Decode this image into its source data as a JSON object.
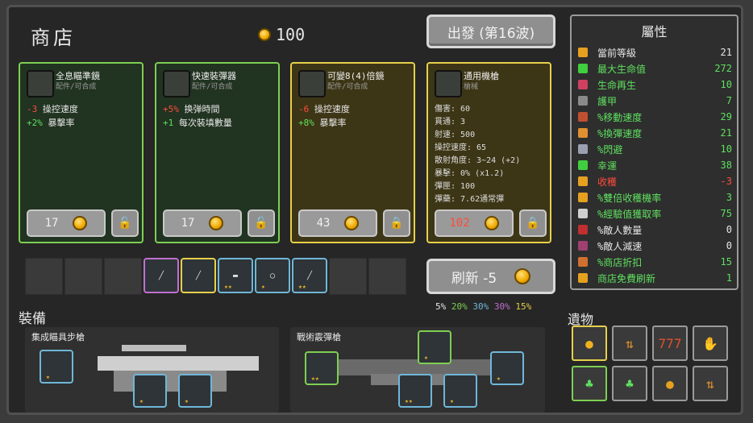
{
  "shop": {
    "title": "商店",
    "gold": "100",
    "go_button": "出發 (第16波)"
  },
  "cards": [
    {
      "name": "全息瞄準鏡",
      "sub": "配件/可合成",
      "stats": [
        {
          "v": "-3",
          "t": "操控速度",
          "c": "red"
        },
        {
          "v": "+2%",
          "t": "暴擊率",
          "c": "grn"
        }
      ],
      "price": "17",
      "icon": "holo-scope-icon"
    },
    {
      "name": "快速裝彈器",
      "sub": "配件/可合成",
      "stats": [
        {
          "v": "+5%",
          "t": "换弹時間",
          "c": "red"
        },
        {
          "v": "+1",
          "t": "每次裝填數量",
          "c": "grn"
        }
      ],
      "price": "17",
      "icon": "speed-loader-icon"
    },
    {
      "name": "可變8(4)倍鏡",
      "sub": "配件/可合成",
      "stats": [
        {
          "v": "-6",
          "t": "操控速度",
          "c": "red"
        },
        {
          "v": "+8%",
          "t": "暴擊率",
          "c": "grn"
        }
      ],
      "price": "43",
      "icon": "variable-scope-icon"
    },
    {
      "name": "通用機槍",
      "sub": "槍械",
      "wstats": [
        "傷害: 60",
        "貫通: 3",
        "射速: 500",
        "操控速度: 65",
        "散射角度: 3~24 (+2)",
        "暴擊: 0% (x1.2)",
        "彈匣: 100",
        "彈藥: 7.62通常彈"
      ],
      "price": "102",
      "icon": "machine-gun-icon"
    }
  ],
  "inventory": [
    {
      "name": "inventory-rifle",
      "color": "#c070d0",
      "stars": ""
    },
    {
      "name": "inventory-gold-rifle",
      "color": "#e6d04a",
      "stars": ""
    },
    {
      "name": "inventory-pistol",
      "color": "#6fb7d8",
      "stars": "★★"
    },
    {
      "name": "inventory-scope",
      "color": "#6fb7d8",
      "stars": "★"
    },
    {
      "name": "inventory-shotgun",
      "color": "#6fb7d8",
      "stars": "★★"
    }
  ],
  "refresh": {
    "label": "刷新 -5"
  },
  "rarity": [
    "5%",
    "20%",
    "30%",
    "30%",
    "15%"
  ],
  "rarity_colors": [
    "#e6e6e6",
    "#7ecf52",
    "#6fb7d8",
    "#c070d0",
    "#e6d04a"
  ],
  "equip": {
    "title": "裝備",
    "weapon1": "集成瞄具步槍",
    "weapon2": "戰術霰彈槍"
  },
  "attributes": {
    "title": "屬性",
    "rows": [
      {
        "label": "當前等級",
        "value": "21",
        "color": "#e6e6e6",
        "icon": "#e6a020"
      },
      {
        "label": "最大生命值",
        "value": "272",
        "color": "#5fe05f",
        "icon": "#3fcf3f"
      },
      {
        "label": "生命再生",
        "value": "10",
        "color": "#5fe05f",
        "icon": "#d04060"
      },
      {
        "label": "護甲",
        "value": "7",
        "color": "#5fe05f",
        "icon": "#8a8a8a"
      },
      {
        "label": "%移動速度",
        "value": "29",
        "color": "#5fe05f",
        "icon": "#c05030"
      },
      {
        "label": "%換彈速度",
        "value": "21",
        "color": "#5fe05f",
        "icon": "#e09030"
      },
      {
        "label": "%閃避",
        "value": "10",
        "color": "#5fe05f",
        "icon": "#9aa0b0"
      },
      {
        "label": "幸運",
        "value": "38",
        "color": "#5fe05f",
        "icon": "#3fcf3f"
      },
      {
        "label": "收穫",
        "value": "-3",
        "color": "#ff4b3b",
        "icon": "#e6a020"
      },
      {
        "label": "%雙倍收穫機率",
        "value": "3",
        "color": "#5fe05f",
        "icon": "#e6a020"
      },
      {
        "label": "%經驗值獲取率",
        "value": "75",
        "color": "#5fe05f",
        "icon": "#cfcfcf"
      },
      {
        "label": "%敵人數量",
        "value": "0",
        "color": "#e6e6e6",
        "icon": "#c03030"
      },
      {
        "label": "%敵人減速",
        "value": "0",
        "color": "#e6e6e6",
        "icon": "#a04070"
      },
      {
        "label": "%商店折扣",
        "value": "15",
        "color": "#5fe05f",
        "icon": "#d07030"
      },
      {
        "label": "商店免費刷新",
        "value": "1",
        "color": "#5fe05f",
        "icon": "#e6a020"
      }
    ]
  },
  "relics": {
    "title": "遺物",
    "items": [
      {
        "name": "coin-pile-relic",
        "glyph": "●",
        "color": "#f0b020",
        "border": "#e6d04a"
      },
      {
        "name": "reload-arrows-relic",
        "glyph": "⇅",
        "color": "#e09030",
        "border": "#9a9a9a"
      },
      {
        "name": "slot-777-relic",
        "glyph": "777",
        "color": "#e05030",
        "border": "#9a9a9a"
      },
      {
        "name": "hand-relic",
        "glyph": "✋",
        "color": "#d0d8e8",
        "border": "#9a9a9a"
      },
      {
        "name": "clover-relic",
        "glyph": "♣",
        "color": "#5fe05f",
        "border": "#7ecf52"
      },
      {
        "name": "clover2-relic",
        "glyph": "♣",
        "color": "#5fe05f",
        "border": "#9a9a9a"
      },
      {
        "name": "bulb-relic",
        "glyph": "●",
        "color": "#e6a020",
        "border": "#9a9a9a"
      },
      {
        "name": "reload2-relic",
        "glyph": "⇅",
        "color": "#e09030",
        "border": "#9a9a9a"
      }
    ]
  }
}
